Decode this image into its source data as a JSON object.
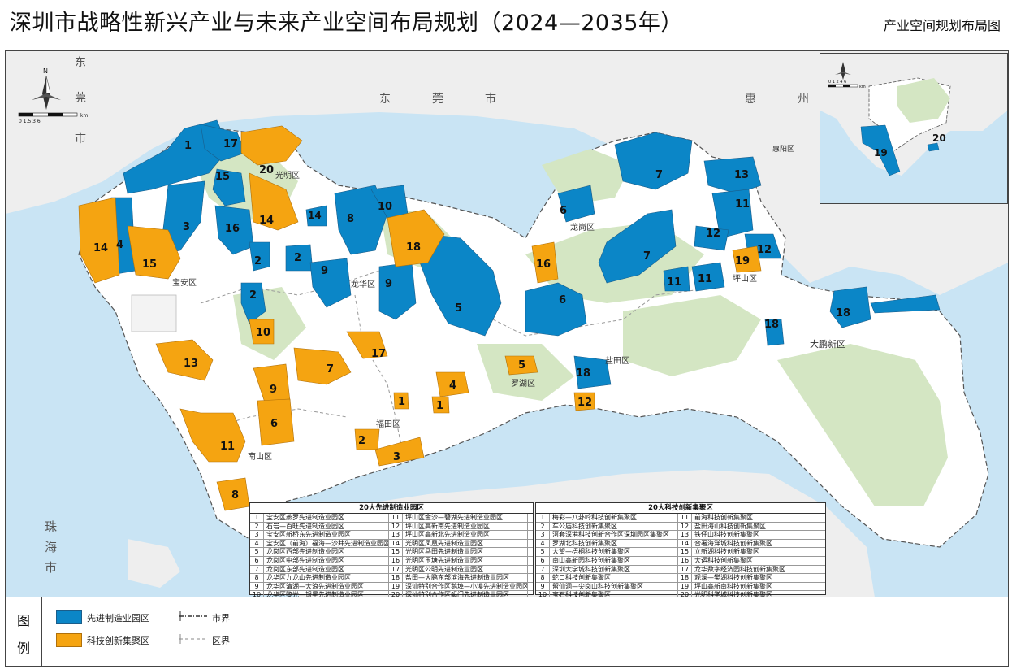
{
  "title": "深圳市战略性新兴产业与未来产业空间布局规划（2024—2035年）",
  "subtitle": "产业空间规划布局图",
  "colors": {
    "advanced_manufacturing": "#0b86c7",
    "innovation_cluster": "#f5a411",
    "water": "#c9e4f4",
    "land_shenzhen": "#ffffff",
    "land_other": "#eeeeee",
    "green": "#d4e6c3"
  },
  "map": {
    "place_labels": {
      "dongguan_1": "东",
      "dongguan_2": "莞",
      "dongguan_3": "市",
      "dongguan_4": "东",
      "dongguan_5": "莞",
      "dongguan_6": "市",
      "huizhou_1": "惠",
      "huizhou_2": "州",
      "zhuhai_1": "珠",
      "zhuhai_2": "海",
      "zhuhai_3": "市",
      "guangming": "光明区",
      "baoan": "宝安区",
      "longhua": "龙华区",
      "longgang": "龙岗区",
      "pingshan": "坪山区",
      "luohu": "罗湖区",
      "futian": "福田区",
      "nanshan": "南山区",
      "yantian": "盐田区",
      "dapeng": "大鹏新区",
      "huiyang": "惠阳区"
    },
    "compass_n": "N",
    "scale_main": "0  1.5  3        6",
    "scale_main_unit": "km",
    "inset_scale": "0 1 2  4   6",
    "inset_scale_unit": "km",
    "manufacturing_labels": [
      "1",
      "17",
      "15",
      "20",
      "3",
      "16",
      "14",
      "4",
      "2",
      "2",
      "9",
      "2",
      "10",
      "8",
      "14",
      "10",
      "9",
      "5",
      "6",
      "7",
      "13",
      "11",
      "12",
      "12",
      "7",
      "11",
      "11",
      "18",
      "19",
      "18"
    ],
    "innovation_labels": [
      "20",
      "14",
      "14",
      "15",
      "18",
      "16",
      "19",
      "13",
      "17",
      "7",
      "9",
      "6",
      "4",
      "5",
      "1",
      "1",
      "11",
      "2",
      "3",
      "8",
      "12",
      "10"
    ]
  },
  "table_manufacturing": {
    "header": "20大先进制造业园区",
    "rows": [
      [
        "1",
        "宝安区燕罗先进制造业园区",
        "11",
        "坪山区金沙—碧湖先进制造业园区"
      ],
      [
        "2",
        "石岩—百旺先进制造业园区",
        "12",
        "坪山区高新南先进制造业园区"
      ],
      [
        "3",
        "宝安区新桥东先进制造业园区",
        "13",
        "坪山区高新北先进制造业园区"
      ],
      [
        "4",
        "宝安区（前海）福海—沙井先进制造业园区",
        "14",
        "光明区凤凰先进制造业园区"
      ],
      [
        "5",
        "龙岗区西部先进制造业园区",
        "15",
        "光明区马田先进制造业园区"
      ],
      [
        "6",
        "龙岗区中部先进制造业园区",
        "16",
        "光明区玉塘先进制造业园区"
      ],
      [
        "7",
        "龙岗区东部先进制造业园区",
        "17",
        "光明区公明先进制造业园区"
      ],
      [
        "8",
        "龙华区九龙山先进制造业园区",
        "18",
        "盐田—大鹏东部滨海先进制造业园区"
      ],
      [
        "9",
        "龙华区清湖—大浪先进制造业园区",
        "19",
        "深汕特别合作区鹅埠—小漠先进制造业园区"
      ],
      [
        "10",
        "龙华区黎光—银星先进制造业园区",
        "20",
        "深汕特别合作区鲘门先进制造业园区"
      ]
    ]
  },
  "table_innovation": {
    "header": "20大科技创新集聚区",
    "rows": [
      [
        "1",
        "梅彩—八卦岭科技创新集聚区",
        "11",
        "前海科技创新集聚区"
      ],
      [
        "2",
        "车公庙科技创新集聚区",
        "12",
        "盐田海山科技创新集聚区"
      ],
      [
        "3",
        "河套深港科技创新合作区深圳园区集聚区",
        "13",
        "铁仔山科技创新集聚区"
      ],
      [
        "4",
        "罗湖北科技创新集聚区",
        "14",
        "合署海洋城科技创新集聚区"
      ],
      [
        "5",
        "大望—梧桐科技创新集聚区",
        "15",
        "立新湖科技创新集聚区"
      ],
      [
        "6",
        "南山高新园科技创新集聚区",
        "16",
        "大运科技创新集聚区"
      ],
      [
        "7",
        "深圳大学城科技创新集聚区",
        "17",
        "龙华数字经济园科技创新集聚区"
      ],
      [
        "8",
        "蛇口科技创新集聚区",
        "18",
        "观澜—樊湖科技创新集聚区"
      ],
      [
        "9",
        "留仙洞—尖岗山科技创新集聚区",
        "19",
        "坪山高新南科技创新集聚区"
      ],
      [
        "10",
        "宝石科技创新集聚区",
        "20",
        "光明科学城科技创新集聚区"
      ]
    ]
  },
  "legend": {
    "title_1": "图",
    "title_2": "例",
    "manufacturing": "先进制造业园区",
    "innovation": "科技创新集聚区",
    "city_boundary": "市界",
    "district_boundary": "区界"
  }
}
